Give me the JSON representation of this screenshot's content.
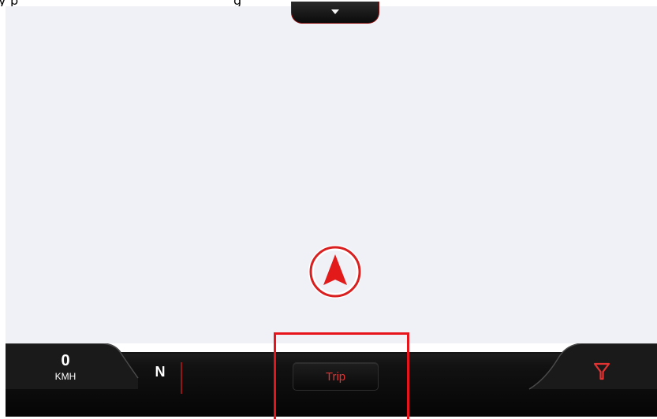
{
  "top_fragment": {
    "left_text": "y p",
    "right_text": "g"
  },
  "status": {
    "speed_value": "0",
    "speed_unit": "KMH",
    "heading": "N"
  },
  "buttons": {
    "trip_label": "Trip"
  },
  "icons": {
    "pull_down": "chevron-down-icon",
    "position": "navigation-arrow-icon",
    "filter": "filter-icon"
  },
  "colors": {
    "accent": "#e33232",
    "map_bg": "#eff1f7",
    "bar": "#0f0f0f",
    "highlight": "#e8141c"
  }
}
